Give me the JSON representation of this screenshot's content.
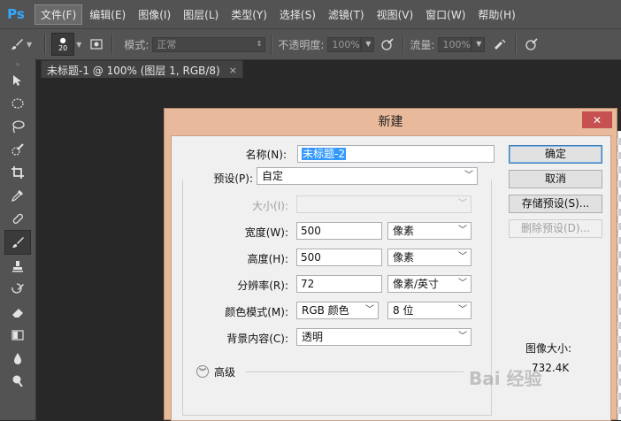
{
  "app": {
    "logo": "Ps",
    "menu": [
      "文件(F)",
      "编辑(E)",
      "图像(I)",
      "图层(L)",
      "类型(Y)",
      "选择(S)",
      "滤镜(T)",
      "视图(V)",
      "窗口(W)",
      "帮助(H)"
    ],
    "active_menu_index": 0
  },
  "options": {
    "brush_size": "20",
    "mode_label": "模式:",
    "mode_value": "正常",
    "opacity_label": "不透明度:",
    "opacity_value": "100%",
    "flow_label": "流量:",
    "flow_value": "100%"
  },
  "document_tab": {
    "title": "未标题-1 @ 100% (图层 1, RGB/8)",
    "close": "×"
  },
  "dialog": {
    "title": "新建",
    "close": "✕",
    "name_label": "名称(N):",
    "name_value": "未标题-2",
    "preset_label": "预设(P):",
    "preset_value": "自定",
    "size_label": "大小(I):",
    "size_value": "",
    "width_label": "宽度(W):",
    "width_value": "500",
    "width_unit": "像素",
    "height_label": "高度(H):",
    "height_value": "500",
    "height_unit": "像素",
    "resolution_label": "分辨率(R):",
    "resolution_value": "72",
    "resolution_unit": "像素/英寸",
    "color_mode_label": "颜色模式(M):",
    "color_mode_value": "RGB 颜色",
    "bit_depth_value": "8 位",
    "background_label": "背景内容(C):",
    "background_value": "透明",
    "advanced_label": "高级",
    "ok_label": "确定",
    "cancel_label": "取消",
    "save_preset_label": "存储预设(S)...",
    "delete_preset_label": "删除预设(D)...",
    "image_size_label": "图像大小:",
    "image_size_value": "732.4K"
  },
  "watermark": "Bai 经验",
  "colors": {
    "dialog_frame": "#e8b99a",
    "close_button": "#c75050",
    "selection": "#3399ff"
  }
}
